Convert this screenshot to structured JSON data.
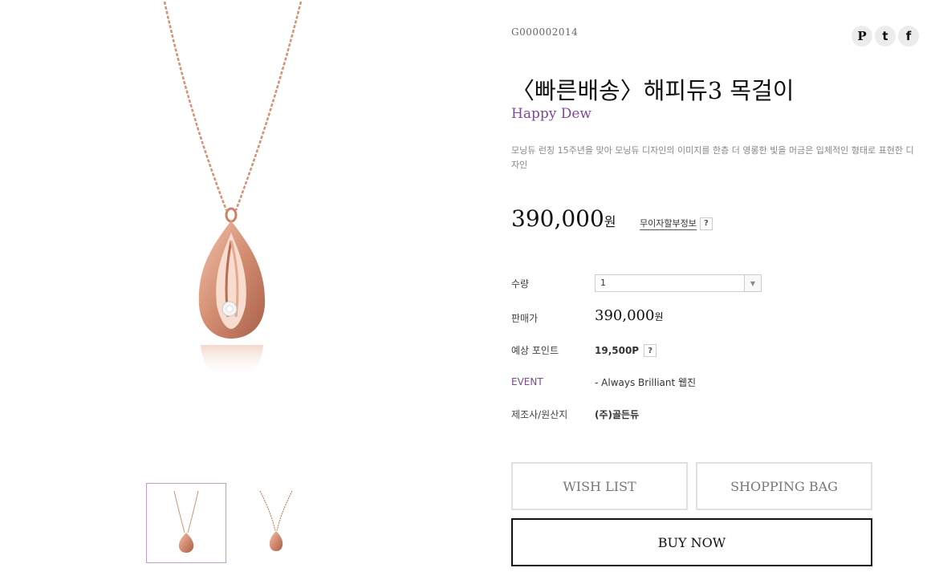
{
  "product": {
    "code": "G000002014",
    "title": "〈빠른배송〉해피듀3 목걸이",
    "subtitle": "Happy Dew",
    "description": "모닝듀 런칭 15주년을 맞아 모닝듀 디자인의 이미지를 한층 더 영롱한 빛을 머금은 입체적인 형태로 표현한 디자인",
    "price_number": "390,000",
    "price_unit": "원",
    "installment_label": "무이자할부정보",
    "help_mark": "?"
  },
  "share": {
    "icons": [
      "pinterest-icon",
      "tumblr-icon",
      "facebook-icon"
    ],
    "pinterest": "P",
    "tumblr": "t",
    "facebook": "f"
  },
  "details": {
    "quantity_label": "수량",
    "quantity_value": "1",
    "sale_price_label": "판매가",
    "sale_price_number": "390,000",
    "sale_price_unit": "원",
    "points_label": "예상 포인트",
    "points_value": "19,500P",
    "event_label": "EVENT",
    "event_value": "- Always Brilliant 웹진",
    "maker_label": "제조사/원산지",
    "maker_value": "(주)골든듀"
  },
  "buttons": {
    "wish_list": "WISH LIST",
    "shopping_bag": "SHOPPING BAG",
    "buy_now": "BUY NOW"
  },
  "colors": {
    "accent_purple": "#7b4b95",
    "rose_gold": "#d89a80",
    "thumb_selected_border": "#c49bcf"
  }
}
